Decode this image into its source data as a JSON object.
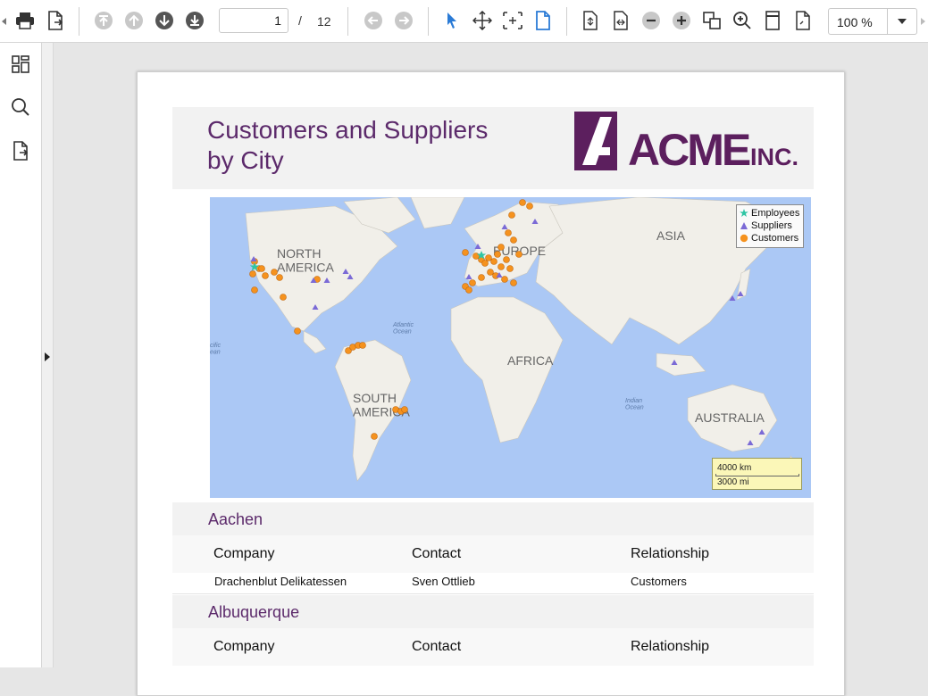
{
  "toolbar": {
    "current_page": "1",
    "page_separator": "/",
    "total_pages": "12",
    "zoom_value": "100 %",
    "icons": [
      "print-icon",
      "export-icon",
      "first-page-icon",
      "previous-page-icon",
      "next-page-icon",
      "last-page-icon",
      "history-back-icon",
      "history-forward-icon",
      "selection-pointer-icon",
      "hand-tool-icon",
      "marquee-zoom-icon",
      "single-page-view-icon",
      "fit-page-icon",
      "fit-width-icon",
      "zoom-out-icon",
      "zoom-in-icon",
      "actual-size-icon",
      "zoom-magnifier-icon",
      "page-layout-icon",
      "multi-page-icon",
      "dropdown-icon"
    ]
  },
  "sidebar": {
    "icons": [
      "thumbnails-icon",
      "search-icon",
      "export-document-icon"
    ]
  },
  "report": {
    "title": "Customers and Suppliers\nby City",
    "logo_text": "ACME",
    "logo_suffix": "INC.",
    "map": {
      "labels": {
        "north_america": "NORTH\nAMERICA",
        "europe": "EUROPE",
        "asia": "ASIA",
        "africa": "AFRICA",
        "south_america": "SOUTH\nAMERICA",
        "australia": "AUSTRALIA",
        "atlantic": "Atlantic\nOcean",
        "indian": "Indian\nOcean",
        "pacific_partial": "cific\nean"
      },
      "legend": {
        "employees": "Employees",
        "suppliers": "Suppliers",
        "customers": "Customers"
      },
      "scale": {
        "km": "4000 km",
        "mi": "3000 mi"
      },
      "colors": {
        "employees": "#2fc5a4",
        "suppliers": "#7b6ad6",
        "customers": "#f5921e",
        "water": "#abc8f5",
        "land": "#f1efe9"
      }
    },
    "sections": [
      {
        "city": "Aachen",
        "headers": {
          "company": "Company",
          "contact": "Contact",
          "relationship": "Relationship"
        },
        "rows": [
          {
            "company": "Drachenblut Delikatessen",
            "contact": "Sven Ottlieb",
            "relationship": "Customers"
          }
        ]
      },
      {
        "city": "Albuquerque",
        "headers": {
          "company": "Company",
          "contact": "Contact",
          "relationship": "Relationship"
        },
        "rows": []
      }
    ]
  }
}
